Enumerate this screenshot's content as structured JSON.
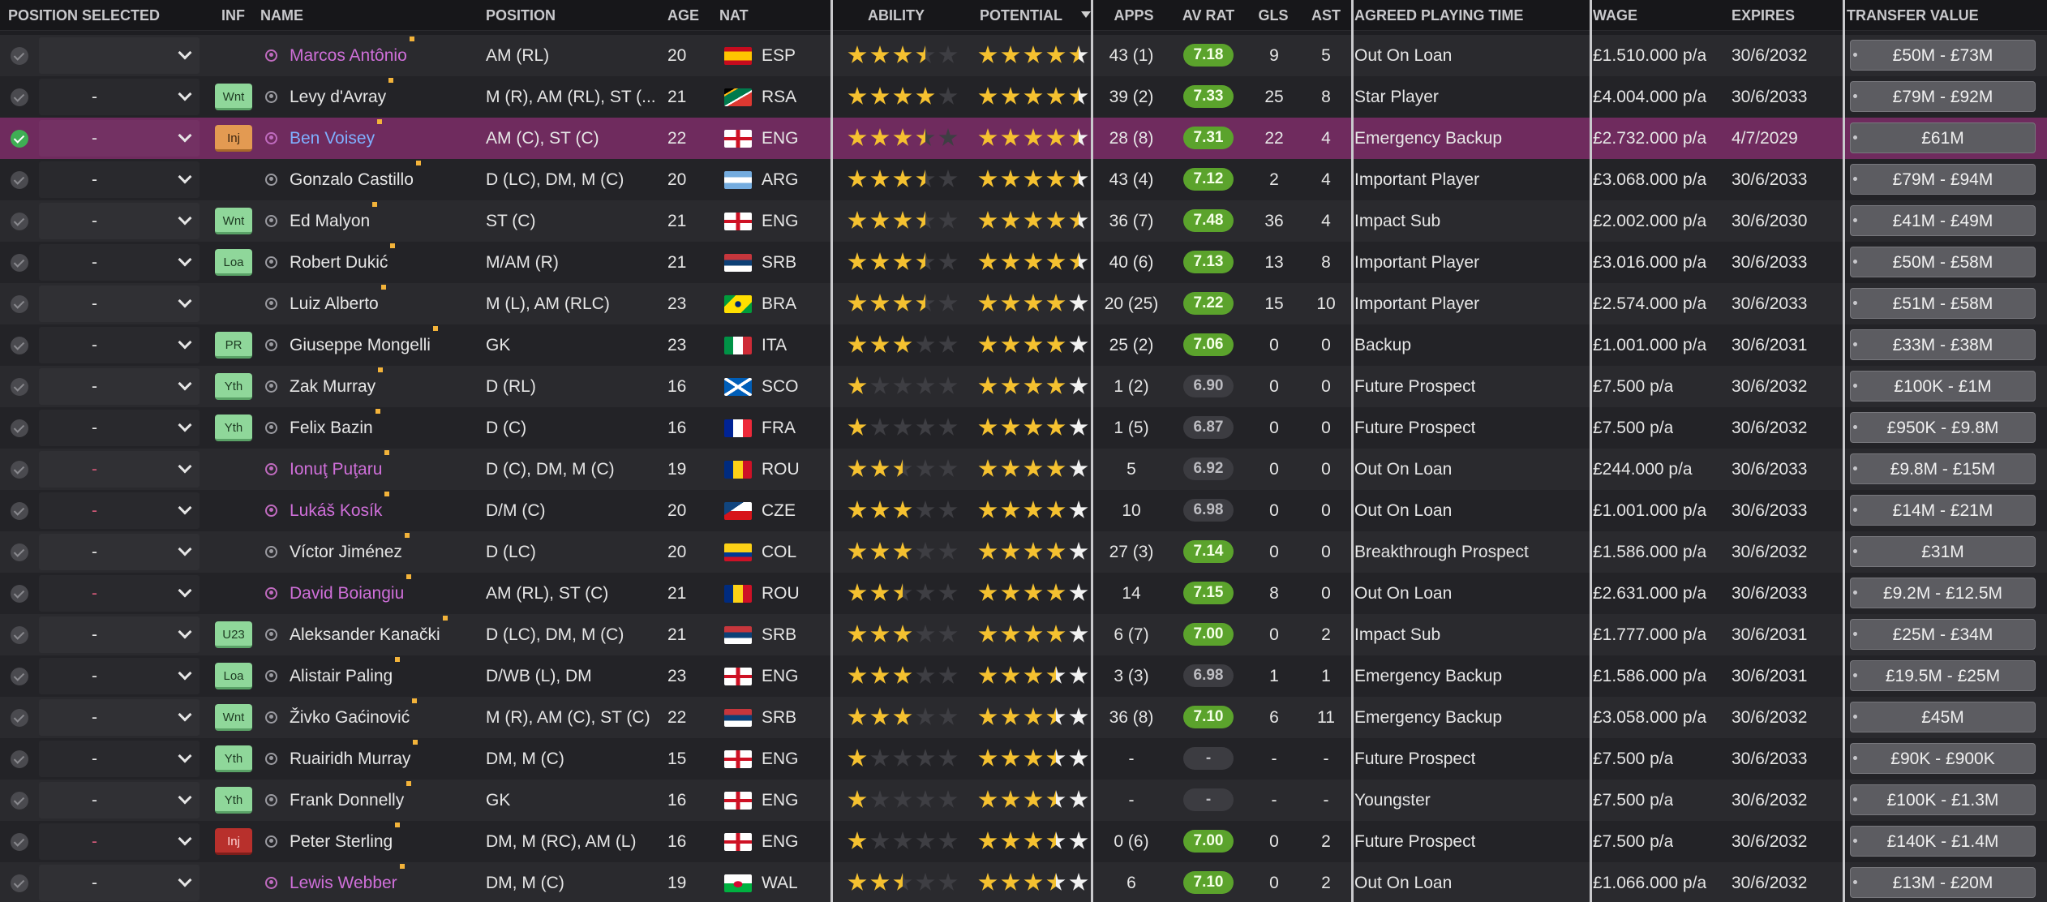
{
  "headers": {
    "position_selected": "POSITION SELECTED",
    "inf": "INF",
    "name": "NAME",
    "position": "POSITION",
    "age": "AGE",
    "nat": "NAT",
    "ability": "ABILITY",
    "potential": "POTENTIAL",
    "apps": "APPS",
    "av_rat": "AV RAT",
    "gls": "GLS",
    "ast": "AST",
    "playing_time": "AGREED PLAYING TIME",
    "wage": "WAGE",
    "expires": "EXPIRES",
    "transfer_value": "TRANSFER VALUE"
  },
  "sort": {
    "column": "potential",
    "direction": "descending",
    "icon": "sort-descending-icon"
  },
  "colors": {
    "selected_row": "#6f2b5e",
    "loan_name": "#cf6fd9",
    "star_gold": "#f5c130",
    "star_white": "#f2f2f2",
    "star_empty": "#3e3e43",
    "rating_green": "#5ba32c"
  },
  "players": [
    {
      "selected": false,
      "pos_sel": "",
      "inf": "",
      "inf_color": "",
      "name": "Marcos Antônio",
      "name_style": "loan",
      "position": "AM (RL)",
      "age": "20",
      "nat": "ESP",
      "ability": 3.5,
      "potential": 4.5,
      "apps": "43 (1)",
      "av_rat": "7.18",
      "rat_style": "green",
      "gls": "9",
      "ast": "5",
      "playing_time": "Out On Loan",
      "wage": "£1.510.000 p/a",
      "expires": "30/6/2032",
      "transfer_value": "£50M - £73M"
    },
    {
      "selected": false,
      "pos_sel": "-",
      "inf": "Wnt",
      "inf_color": "green",
      "name": "Levy d'Avray",
      "name_style": "normal",
      "position": "M (R), AM (RL), ST (...",
      "age": "21",
      "nat": "RSA",
      "ability": 4,
      "potential": 4.5,
      "apps": "39 (2)",
      "av_rat": "7.33",
      "rat_style": "green",
      "gls": "25",
      "ast": "8",
      "playing_time": "Star Player",
      "wage": "£4.004.000 p/a",
      "expires": "30/6/2033",
      "transfer_value": "£79M - £92M"
    },
    {
      "selected": true,
      "pos_sel": "-",
      "inf": "Inj",
      "inf_color": "orange",
      "name": "Ben Voisey",
      "name_style": "sel",
      "position": "AM (C), ST (C)",
      "age": "22",
      "nat": "ENG",
      "ability": 3.5,
      "potential": 4.5,
      "apps": "28 (8)",
      "av_rat": "7.31",
      "rat_style": "green",
      "gls": "22",
      "ast": "4",
      "playing_time": "Emergency Backup",
      "wage": "£2.732.000 p/a",
      "expires": "4/7/2029",
      "transfer_value": "£61M"
    },
    {
      "selected": false,
      "pos_sel": "-",
      "inf": "",
      "inf_color": "",
      "name": "Gonzalo Castillo",
      "name_style": "normal",
      "position": "D (LC), DM, M (C)",
      "age": "20",
      "nat": "ARG",
      "ability": 3.5,
      "potential": 4.5,
      "apps": "43 (4)",
      "av_rat": "7.12",
      "rat_style": "green",
      "gls": "2",
      "ast": "4",
      "playing_time": "Important Player",
      "wage": "£3.068.000 p/a",
      "expires": "30/6/2033",
      "transfer_value": "£79M - £94M"
    },
    {
      "selected": false,
      "pos_sel": "-",
      "inf": "Wnt",
      "inf_color": "green",
      "name": "Ed Malyon",
      "name_style": "normal",
      "position": "ST (C)",
      "age": "21",
      "nat": "ENG",
      "ability": 3.5,
      "potential": 4.5,
      "apps": "36 (7)",
      "av_rat": "7.48",
      "rat_style": "green",
      "gls": "36",
      "ast": "4",
      "playing_time": "Impact Sub",
      "wage": "£2.002.000 p/a",
      "expires": "30/6/2030",
      "transfer_value": "£41M - £49M"
    },
    {
      "selected": false,
      "pos_sel": "-",
      "inf": "Loa",
      "inf_color": "green",
      "name": "Robert Dukić",
      "name_style": "normal",
      "position": "M/AM (R)",
      "age": "21",
      "nat": "SRB",
      "ability": 3.5,
      "potential": 4.5,
      "apps": "40 (6)",
      "av_rat": "7.13",
      "rat_style": "green",
      "gls": "13",
      "ast": "8",
      "playing_time": "Important Player",
      "wage": "£3.016.000 p/a",
      "expires": "30/6/2033",
      "transfer_value": "£50M - £58M"
    },
    {
      "selected": false,
      "pos_sel": "-",
      "inf": "",
      "inf_color": "",
      "name": "Luiz Alberto",
      "name_style": "normal",
      "position": "M (L), AM (RLC)",
      "age": "23",
      "nat": "BRA",
      "ability": 3.5,
      "potential": 4,
      "apps": "20 (25)",
      "av_rat": "7.22",
      "rat_style": "green",
      "gls": "15",
      "ast": "10",
      "playing_time": "Important Player",
      "wage": "£2.574.000 p/a",
      "expires": "30/6/2033",
      "transfer_value": "£51M - £58M"
    },
    {
      "selected": false,
      "pos_sel": "-",
      "inf": "PR",
      "inf_color": "green",
      "name": "Giuseppe Mongelli",
      "name_style": "normal",
      "position": "GK",
      "age": "23",
      "nat": "ITA",
      "ability": 3,
      "potential": 4,
      "apps": "25 (2)",
      "av_rat": "7.06",
      "rat_style": "green",
      "gls": "0",
      "ast": "0",
      "playing_time": "Backup",
      "wage": "£1.001.000 p/a",
      "expires": "30/6/2031",
      "transfer_value": "£33M - £38M"
    },
    {
      "selected": false,
      "pos_sel": "-",
      "inf": "Yth",
      "inf_color": "green",
      "name": "Zak Murray",
      "name_style": "normal",
      "position": "D (RL)",
      "age": "16",
      "nat": "SCO",
      "ability": 1,
      "potential": 4,
      "apps": "1 (2)",
      "av_rat": "6.90",
      "rat_style": "grey",
      "gls": "0",
      "ast": "0",
      "playing_time": "Future Prospect",
      "wage": "£7.500 p/a",
      "expires": "30/6/2032",
      "transfer_value": "£100K - £1M"
    },
    {
      "selected": false,
      "pos_sel": "-",
      "inf": "Yth",
      "inf_color": "green",
      "name": "Felix Bazin",
      "name_style": "normal",
      "position": "D (C)",
      "age": "16",
      "nat": "FRA",
      "ability": 1,
      "potential": 4,
      "apps": "1 (5)",
      "av_rat": "6.87",
      "rat_style": "grey",
      "gls": "0",
      "ast": "0",
      "playing_time": "Future Prospect",
      "wage": "£7.500 p/a",
      "expires": "30/6/2032",
      "transfer_value": "£950K - £9.8M"
    },
    {
      "selected": false,
      "pos_sel": "-",
      "pos_sel_pink": true,
      "inf": "",
      "inf_color": "",
      "name": "Ionuţ Puţaru",
      "name_style": "loan",
      "position": "D (C), DM, M (C)",
      "age": "19",
      "nat": "ROU",
      "ability": 2.5,
      "potential": 4,
      "apps": "5",
      "av_rat": "6.92",
      "rat_style": "grey",
      "gls": "0",
      "ast": "0",
      "playing_time": "Out On Loan",
      "wage": "£244.000 p/a",
      "expires": "30/6/2033",
      "transfer_value": "£9.8M - £15M"
    },
    {
      "selected": false,
      "pos_sel": "-",
      "pos_sel_pink": true,
      "inf": "",
      "inf_color": "",
      "name": "Lukáš Kosík",
      "name_style": "loan",
      "position": "D/M (C)",
      "age": "20",
      "nat": "CZE",
      "ability": 3,
      "potential": 4,
      "apps": "10",
      "av_rat": "6.98",
      "rat_style": "grey",
      "gls": "0",
      "ast": "0",
      "playing_time": "Out On Loan",
      "wage": "£1.001.000 p/a",
      "expires": "30/6/2033",
      "transfer_value": "£14M - £21M"
    },
    {
      "selected": false,
      "pos_sel": "-",
      "inf": "",
      "inf_color": "",
      "name": "Víctor Jiménez",
      "name_style": "normal",
      "position": "D (LC)",
      "age": "20",
      "nat": "COL",
      "ability": 3,
      "potential": 4,
      "apps": "27 (3)",
      "av_rat": "7.14",
      "rat_style": "green",
      "gls": "0",
      "ast": "0",
      "playing_time": "Breakthrough Prospect",
      "wage": "£1.586.000 p/a",
      "expires": "30/6/2032",
      "transfer_value": "£31M"
    },
    {
      "selected": false,
      "pos_sel": "-",
      "pos_sel_pink": true,
      "inf": "",
      "inf_color": "",
      "name": "David Boiangiu",
      "name_style": "loan",
      "position": "AM (RL), ST (C)",
      "age": "21",
      "nat": "ROU",
      "ability": 2.5,
      "potential": 4,
      "apps": "14",
      "av_rat": "7.15",
      "rat_style": "green",
      "gls": "8",
      "ast": "0",
      "playing_time": "Out On Loan",
      "wage": "£2.631.000 p/a",
      "expires": "30/6/2033",
      "transfer_value": "£9.2M - £12.5M"
    },
    {
      "selected": false,
      "pos_sel": "-",
      "inf": "U23",
      "inf_color": "green",
      "name": "Aleksander Kanački",
      "name_style": "normal",
      "position": "D (LC), DM, M (C)",
      "age": "21",
      "nat": "SRB",
      "ability": 3,
      "potential": 4,
      "apps": "6 (7)",
      "av_rat": "7.00",
      "rat_style": "green",
      "gls": "0",
      "ast": "2",
      "playing_time": "Impact Sub",
      "wage": "£1.777.000 p/a",
      "expires": "30/6/2031",
      "transfer_value": "£25M - £34M"
    },
    {
      "selected": false,
      "pos_sel": "-",
      "inf": "Loa",
      "inf_color": "green",
      "name": "Alistair Paling",
      "name_style": "normal",
      "position": "D/WB (L), DM",
      "age": "23",
      "nat": "ENG",
      "ability": 3,
      "potential": 3.5,
      "apps": "3 (3)",
      "av_rat": "6.98",
      "rat_style": "grey",
      "gls": "1",
      "ast": "1",
      "playing_time": "Emergency Backup",
      "wage": "£1.586.000 p/a",
      "expires": "30/6/2031",
      "transfer_value": "£19.5M - £25M"
    },
    {
      "selected": false,
      "pos_sel": "-",
      "inf": "Wnt",
      "inf_color": "green",
      "name": "Živko Gaćinović",
      "name_style": "normal",
      "position": "M (R), AM (C), ST (C)",
      "age": "22",
      "nat": "SRB",
      "ability": 3,
      "potential": 3.5,
      "apps": "36 (8)",
      "av_rat": "7.10",
      "rat_style": "green",
      "gls": "6",
      "ast": "11",
      "playing_time": "Emergency Backup",
      "wage": "£3.058.000 p/a",
      "expires": "30/6/2032",
      "transfer_value": "£45M"
    },
    {
      "selected": false,
      "pos_sel": "-",
      "inf": "Yth",
      "inf_color": "green",
      "name": "Ruairidh Murray",
      "name_style": "normal",
      "position": "DM, M (C)",
      "age": "15",
      "nat": "ENG",
      "ability": 1,
      "potential": 3.5,
      "apps": "-",
      "av_rat": "-",
      "rat_style": "grey",
      "gls": "-",
      "ast": "-",
      "playing_time": "Future Prospect",
      "wage": "£7.500 p/a",
      "expires": "30/6/2033",
      "transfer_value": "£90K - £900K"
    },
    {
      "selected": false,
      "pos_sel": "-",
      "inf": "Yth",
      "inf_color": "green",
      "name": "Frank Donnelly",
      "name_style": "normal",
      "position": "GK",
      "age": "16",
      "nat": "ENG",
      "ability": 1,
      "potential": 3.5,
      "apps": "-",
      "av_rat": "-",
      "rat_style": "grey",
      "gls": "-",
      "ast": "-",
      "playing_time": "Youngster",
      "wage": "£7.500 p/a",
      "expires": "30/6/2032",
      "transfer_value": "£100K - £1.3M"
    },
    {
      "selected": false,
      "pos_sel": "-",
      "pos_sel_pink": true,
      "inf": "Inj",
      "inf_color": "red",
      "name": "Peter Sterling",
      "name_style": "normal",
      "position": "DM, M (RC), AM (L)",
      "age": "16",
      "nat": "ENG",
      "ability": 1,
      "potential": 3.5,
      "apps": "0 (6)",
      "av_rat": "7.00",
      "rat_style": "green",
      "gls": "0",
      "ast": "2",
      "playing_time": "Future Prospect",
      "wage": "£7.500 p/a",
      "expires": "30/6/2032",
      "transfer_value": "£140K - £1.4M"
    },
    {
      "selected": false,
      "pos_sel": "-",
      "inf": "",
      "inf_color": "",
      "name": "Lewis Webber",
      "name_style": "loan",
      "position": "DM, M (C)",
      "age": "19",
      "nat": "WAL",
      "ability": 2.5,
      "potential": 3.5,
      "apps": "6",
      "av_rat": "7.10",
      "rat_style": "green",
      "gls": "0",
      "ast": "2",
      "playing_time": "Out On Loan",
      "wage": "£1.066.000 p/a",
      "expires": "30/6/2032",
      "transfer_value": "£13M - £20M"
    }
  ]
}
